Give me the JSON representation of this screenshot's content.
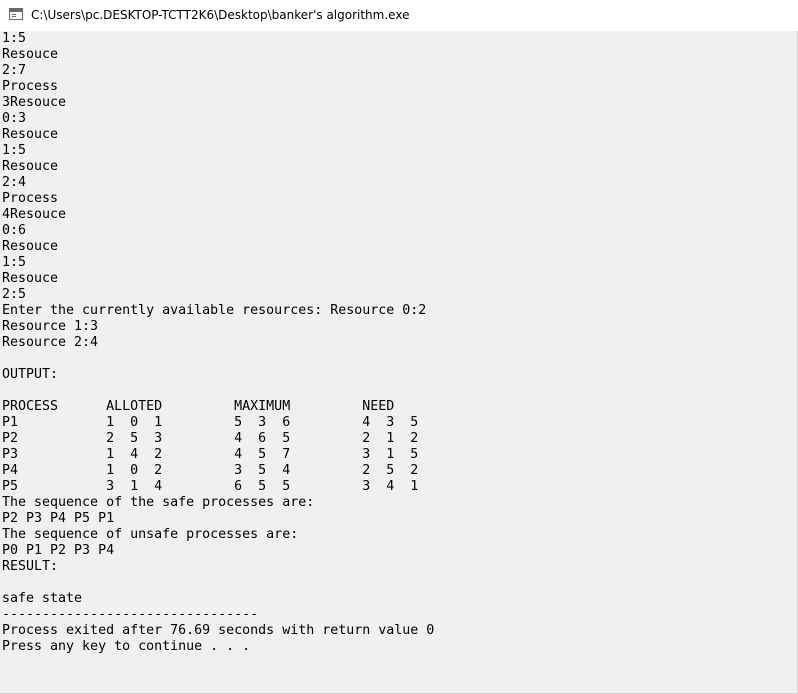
{
  "window": {
    "title": "C:\\Users\\pc.DESKTOP-TCTT2K6\\Desktop\\banker's algorithm.exe",
    "icon": "console-app-icon"
  },
  "console": {
    "lines": [
      "1:5",
      "Resouce",
      "2:7",
      "Process",
      "3Resouce",
      "0:3",
      "Resouce",
      "1:5",
      "Resouce",
      "2:4",
      "Process",
      "4Resouce",
      "0:6",
      "Resouce",
      "1:5",
      "Resouce",
      "2:5",
      "Enter the currently available resources: Resource 0:2",
      "Resource 1:3",
      "Resource 2:4",
      "",
      "OUTPUT:",
      "",
      "PROCESS      ALLOTED         MAXIMUM         NEED",
      "P1           1  0  1         5  3  6         4  3  5",
      "P2           2  5  3         4  6  5         2  1  2",
      "P3           1  4  2         4  5  7         3  1  5",
      "P4           1  0  2         3  5  4         2  5  2",
      "P5           3  1  4         6  5  5         3  4  1",
      "The sequence of the safe processes are:",
      "P2 P3 P4 P5 P1",
      "The sequence of unsafe processes are:",
      "P0 P1 P2 P3 P4",
      "RESULT:",
      "",
      "safe state",
      "--------------------------------",
      "Process exited after 76.69 seconds with return value 0",
      "Press any key to continue . . ."
    ]
  }
}
